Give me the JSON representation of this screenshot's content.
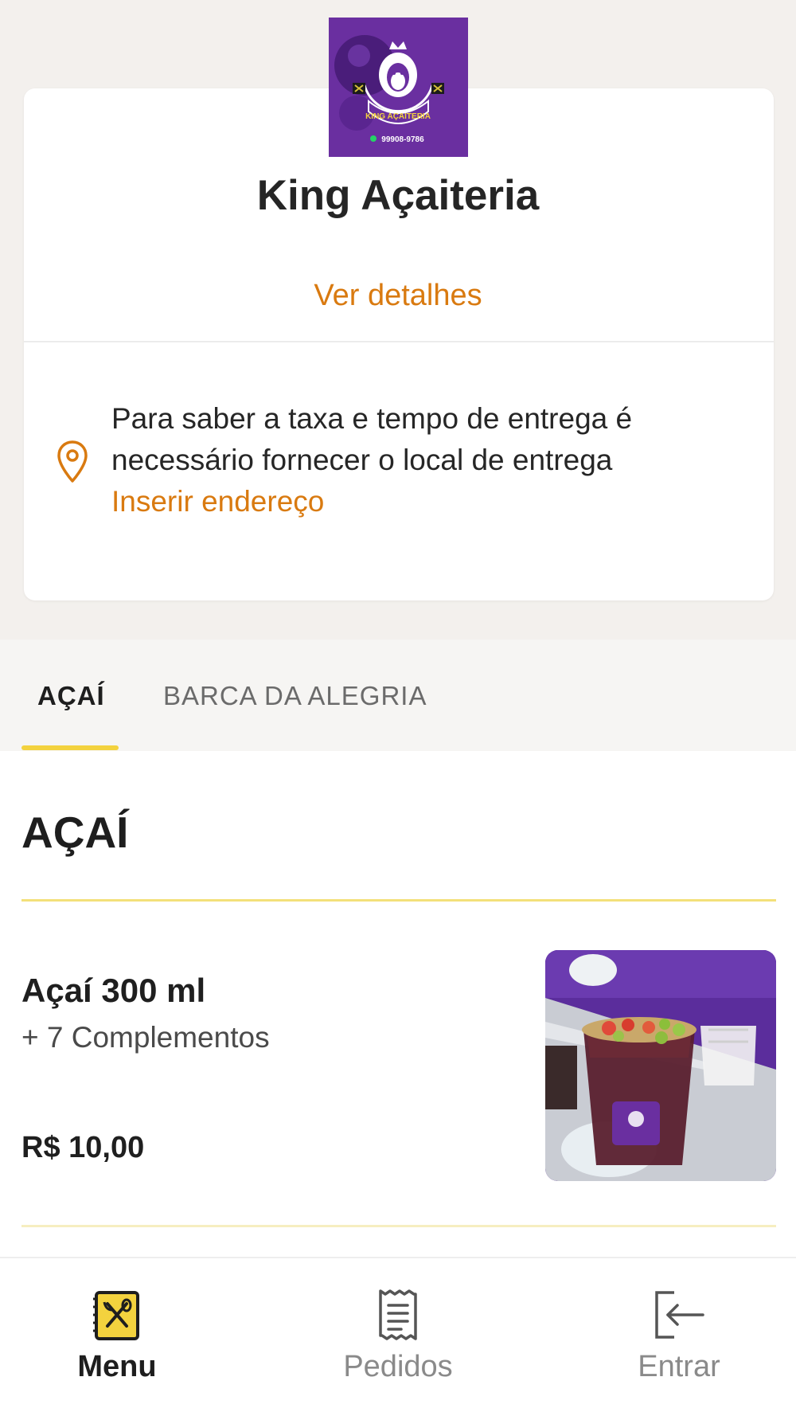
{
  "store": {
    "name": "King Açaiteria",
    "details_link": "Ver detalhes",
    "logo": {
      "brand_text": "KING AÇAITERIA",
      "phone": "99908-9786"
    }
  },
  "delivery": {
    "message": "Para saber a taxa e tempo de entrega é necessário fornecer o local de entrega",
    "address_link": "Inserir endereço",
    "icon": "location-pin-icon"
  },
  "tabs": [
    {
      "label": "AÇAÍ",
      "active": true
    },
    {
      "label": "BARCA DA ALEGRIA",
      "active": false
    }
  ],
  "section": {
    "title": "AÇAÍ"
  },
  "products": [
    {
      "name": "Açaí 300 ml",
      "description": "+ 7 Complementos",
      "price": "R$ 10,00"
    }
  ],
  "bottom_nav": [
    {
      "label": "Menu",
      "icon": "menu-book-icon",
      "active": true
    },
    {
      "label": "Pedidos",
      "icon": "receipt-icon",
      "active": false
    },
    {
      "label": "Entrar",
      "icon": "login-icon",
      "active": false
    }
  ],
  "colors": {
    "accent_orange": "#d97a10",
    "accent_yellow": "#f3d23e",
    "brand_purple": "#6a2fa0",
    "page_background": "#f3f0ed"
  }
}
